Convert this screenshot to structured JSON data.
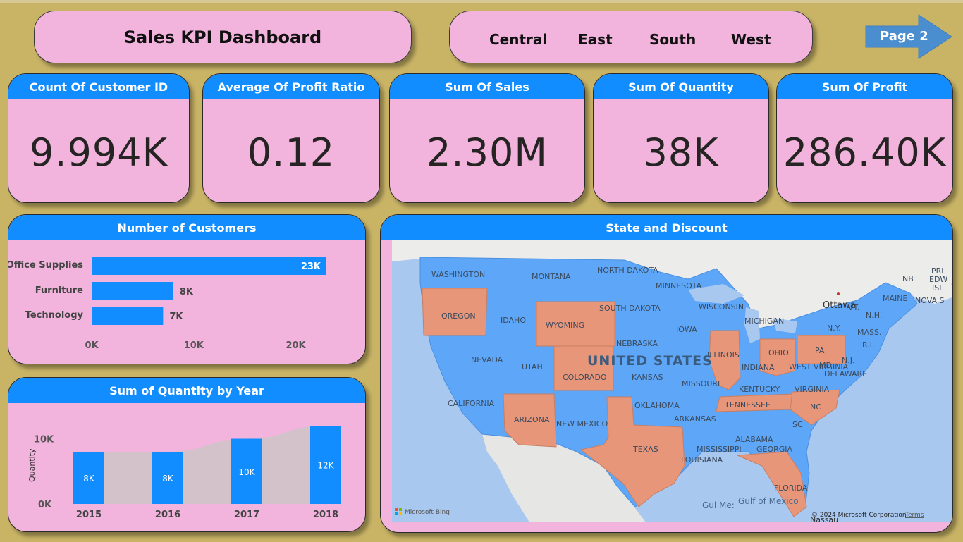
{
  "header": {
    "title": "Sales KPI Dashboard"
  },
  "regions": [
    "Central",
    "East",
    "South",
    "West"
  ],
  "nav": {
    "next_page_label": "Page 2"
  },
  "kpis": [
    {
      "label": "Count Of Customer ID",
      "value": "9.994K"
    },
    {
      "label": "Average Of Profit Ratio",
      "value": "0.12"
    },
    {
      "label": "Sum Of Sales",
      "value": "2.30M"
    },
    {
      "label": "Sum Of Quantity",
      "value": "38K"
    },
    {
      "label": "Sum Of Profit",
      "value": "286.40K"
    }
  ],
  "customers_chart": {
    "title": "Number of Customers",
    "categories": [
      "Office Supplies",
      "Furniture",
      "Technology"
    ],
    "value_labels": [
      "23K",
      "8K",
      "7K"
    ],
    "tick_labels": [
      "0K",
      "10K",
      "20K"
    ]
  },
  "quantity_chart": {
    "title": "Sum of Quantity by Year",
    "ylabel": "Quantity",
    "ytick_labels": [
      "0K",
      "10K"
    ],
    "categories": [
      "2015",
      "2016",
      "2017",
      "2018"
    ],
    "value_labels": [
      "8K",
      "8K",
      "10K",
      "12K"
    ]
  },
  "map": {
    "title": "State and Discount",
    "country_label": "UNITED STATES",
    "highlight_color": "#e8967a",
    "base_color": "#5ea6f7",
    "state_labels": [
      "WASHINGTON",
      "MONTANA",
      "NORTH DAKOTA",
      "MINNESOTA",
      "SOUTH DAKOTA",
      "WISCONSIN",
      "MICHIGAN",
      "OREGON",
      "IDAHO",
      "WYOMING",
      "IOWA",
      "NEBRASKA",
      "ILLINOIS",
      "INDIANA",
      "OHIO",
      "PA",
      "NEVADA",
      "UTAH",
      "COLORADO",
      "KANSAS",
      "MISSOURI",
      "KENTUCKY",
      "WEST VIRGINIA",
      "VIRGINIA",
      "CALIFORNIA",
      "OKLAHOMA",
      "TENNESSEE",
      "NC",
      "ARIZONA",
      "NEW MEXICO",
      "ARKANSAS",
      "SC",
      "TEXAS",
      "MISSISSIPPI",
      "ALABAMA",
      "GEORGIA",
      "LOUISIANA",
      "FLORIDA",
      "MAINE",
      "N.Y.",
      "MASS.",
      "R.I.",
      "MD.",
      "DELAWARE",
      "N.J.",
      "VT.",
      "N.H.",
      "NB",
      "PRI",
      "EDW",
      "ISL",
      "NOVA S",
      "Ottawa"
    ],
    "water_labels": [
      "Gulf of Mexico",
      "Gul Me:",
      "Nassau"
    ],
    "provider": "Microsoft Bing",
    "copyright": "© 2024 Microsoft Corporation",
    "terms": "Terms"
  },
  "chart_data": [
    {
      "type": "bar",
      "orientation": "horizontal",
      "title": "Number of Customers",
      "categories": [
        "Office Supplies",
        "Furniture",
        "Technology"
      ],
      "values": [
        23000,
        8000,
        7000
      ],
      "xlim": [
        0,
        25000
      ],
      "tick_labels": [
        "0K",
        "10K",
        "20K"
      ],
      "color": "#118dff"
    },
    {
      "type": "bar",
      "title": "Sum of Quantity by Year",
      "ylabel": "Quantity",
      "categories": [
        "2015",
        "2016",
        "2017",
        "2018"
      ],
      "values": [
        8000,
        8000,
        10000,
        12000
      ],
      "ylim": [
        0,
        12000
      ],
      "color": "#118dff",
      "area_color": "#d4c2ca"
    }
  ]
}
